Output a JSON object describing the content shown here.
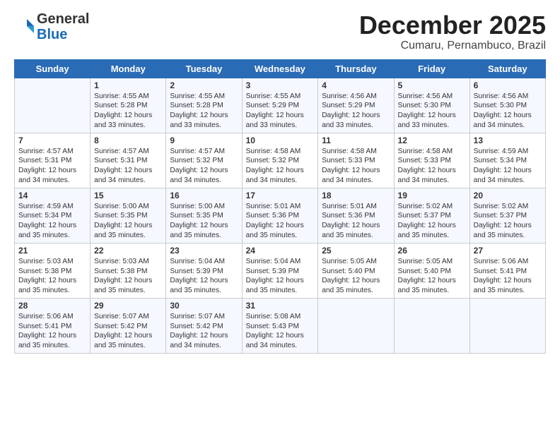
{
  "header": {
    "logo_line1": "General",
    "logo_line2": "Blue",
    "month_title": "December 2025",
    "location": "Cumaru, Pernambuco, Brazil"
  },
  "days_of_week": [
    "Sunday",
    "Monday",
    "Tuesday",
    "Wednesday",
    "Thursday",
    "Friday",
    "Saturday"
  ],
  "weeks": [
    [
      {
        "day": "",
        "content": ""
      },
      {
        "day": "1",
        "content": "Sunrise: 4:55 AM\nSunset: 5:28 PM\nDaylight: 12 hours\nand 33 minutes."
      },
      {
        "day": "2",
        "content": "Sunrise: 4:55 AM\nSunset: 5:28 PM\nDaylight: 12 hours\nand 33 minutes."
      },
      {
        "day": "3",
        "content": "Sunrise: 4:55 AM\nSunset: 5:29 PM\nDaylight: 12 hours\nand 33 minutes."
      },
      {
        "day": "4",
        "content": "Sunrise: 4:56 AM\nSunset: 5:29 PM\nDaylight: 12 hours\nand 33 minutes."
      },
      {
        "day": "5",
        "content": "Sunrise: 4:56 AM\nSunset: 5:30 PM\nDaylight: 12 hours\nand 33 minutes."
      },
      {
        "day": "6",
        "content": "Sunrise: 4:56 AM\nSunset: 5:30 PM\nDaylight: 12 hours\nand 34 minutes."
      }
    ],
    [
      {
        "day": "7",
        "content": "Sunrise: 4:57 AM\nSunset: 5:31 PM\nDaylight: 12 hours\nand 34 minutes."
      },
      {
        "day": "8",
        "content": "Sunrise: 4:57 AM\nSunset: 5:31 PM\nDaylight: 12 hours\nand 34 minutes."
      },
      {
        "day": "9",
        "content": "Sunrise: 4:57 AM\nSunset: 5:32 PM\nDaylight: 12 hours\nand 34 minutes."
      },
      {
        "day": "10",
        "content": "Sunrise: 4:58 AM\nSunset: 5:32 PM\nDaylight: 12 hours\nand 34 minutes."
      },
      {
        "day": "11",
        "content": "Sunrise: 4:58 AM\nSunset: 5:33 PM\nDaylight: 12 hours\nand 34 minutes."
      },
      {
        "day": "12",
        "content": "Sunrise: 4:58 AM\nSunset: 5:33 PM\nDaylight: 12 hours\nand 34 minutes."
      },
      {
        "day": "13",
        "content": "Sunrise: 4:59 AM\nSunset: 5:34 PM\nDaylight: 12 hours\nand 34 minutes."
      }
    ],
    [
      {
        "day": "14",
        "content": "Sunrise: 4:59 AM\nSunset: 5:34 PM\nDaylight: 12 hours\nand 35 minutes."
      },
      {
        "day": "15",
        "content": "Sunrise: 5:00 AM\nSunset: 5:35 PM\nDaylight: 12 hours\nand 35 minutes."
      },
      {
        "day": "16",
        "content": "Sunrise: 5:00 AM\nSunset: 5:35 PM\nDaylight: 12 hours\nand 35 minutes."
      },
      {
        "day": "17",
        "content": "Sunrise: 5:01 AM\nSunset: 5:36 PM\nDaylight: 12 hours\nand 35 minutes."
      },
      {
        "day": "18",
        "content": "Sunrise: 5:01 AM\nSunset: 5:36 PM\nDaylight: 12 hours\nand 35 minutes."
      },
      {
        "day": "19",
        "content": "Sunrise: 5:02 AM\nSunset: 5:37 PM\nDaylight: 12 hours\nand 35 minutes."
      },
      {
        "day": "20",
        "content": "Sunrise: 5:02 AM\nSunset: 5:37 PM\nDaylight: 12 hours\nand 35 minutes."
      }
    ],
    [
      {
        "day": "21",
        "content": "Sunrise: 5:03 AM\nSunset: 5:38 PM\nDaylight: 12 hours\nand 35 minutes."
      },
      {
        "day": "22",
        "content": "Sunrise: 5:03 AM\nSunset: 5:38 PM\nDaylight: 12 hours\nand 35 minutes."
      },
      {
        "day": "23",
        "content": "Sunrise: 5:04 AM\nSunset: 5:39 PM\nDaylight: 12 hours\nand 35 minutes."
      },
      {
        "day": "24",
        "content": "Sunrise: 5:04 AM\nSunset: 5:39 PM\nDaylight: 12 hours\nand 35 minutes."
      },
      {
        "day": "25",
        "content": "Sunrise: 5:05 AM\nSunset: 5:40 PM\nDaylight: 12 hours\nand 35 minutes."
      },
      {
        "day": "26",
        "content": "Sunrise: 5:05 AM\nSunset: 5:40 PM\nDaylight: 12 hours\nand 35 minutes."
      },
      {
        "day": "27",
        "content": "Sunrise: 5:06 AM\nSunset: 5:41 PM\nDaylight: 12 hours\nand 35 minutes."
      }
    ],
    [
      {
        "day": "28",
        "content": "Sunrise: 5:06 AM\nSunset: 5:41 PM\nDaylight: 12 hours\nand 35 minutes."
      },
      {
        "day": "29",
        "content": "Sunrise: 5:07 AM\nSunset: 5:42 PM\nDaylight: 12 hours\nand 35 minutes."
      },
      {
        "day": "30",
        "content": "Sunrise: 5:07 AM\nSunset: 5:42 PM\nDaylight: 12 hours\nand 34 minutes."
      },
      {
        "day": "31",
        "content": "Sunrise: 5:08 AM\nSunset: 5:43 PM\nDaylight: 12 hours\nand 34 minutes."
      },
      {
        "day": "",
        "content": ""
      },
      {
        "day": "",
        "content": ""
      },
      {
        "day": "",
        "content": ""
      }
    ]
  ]
}
